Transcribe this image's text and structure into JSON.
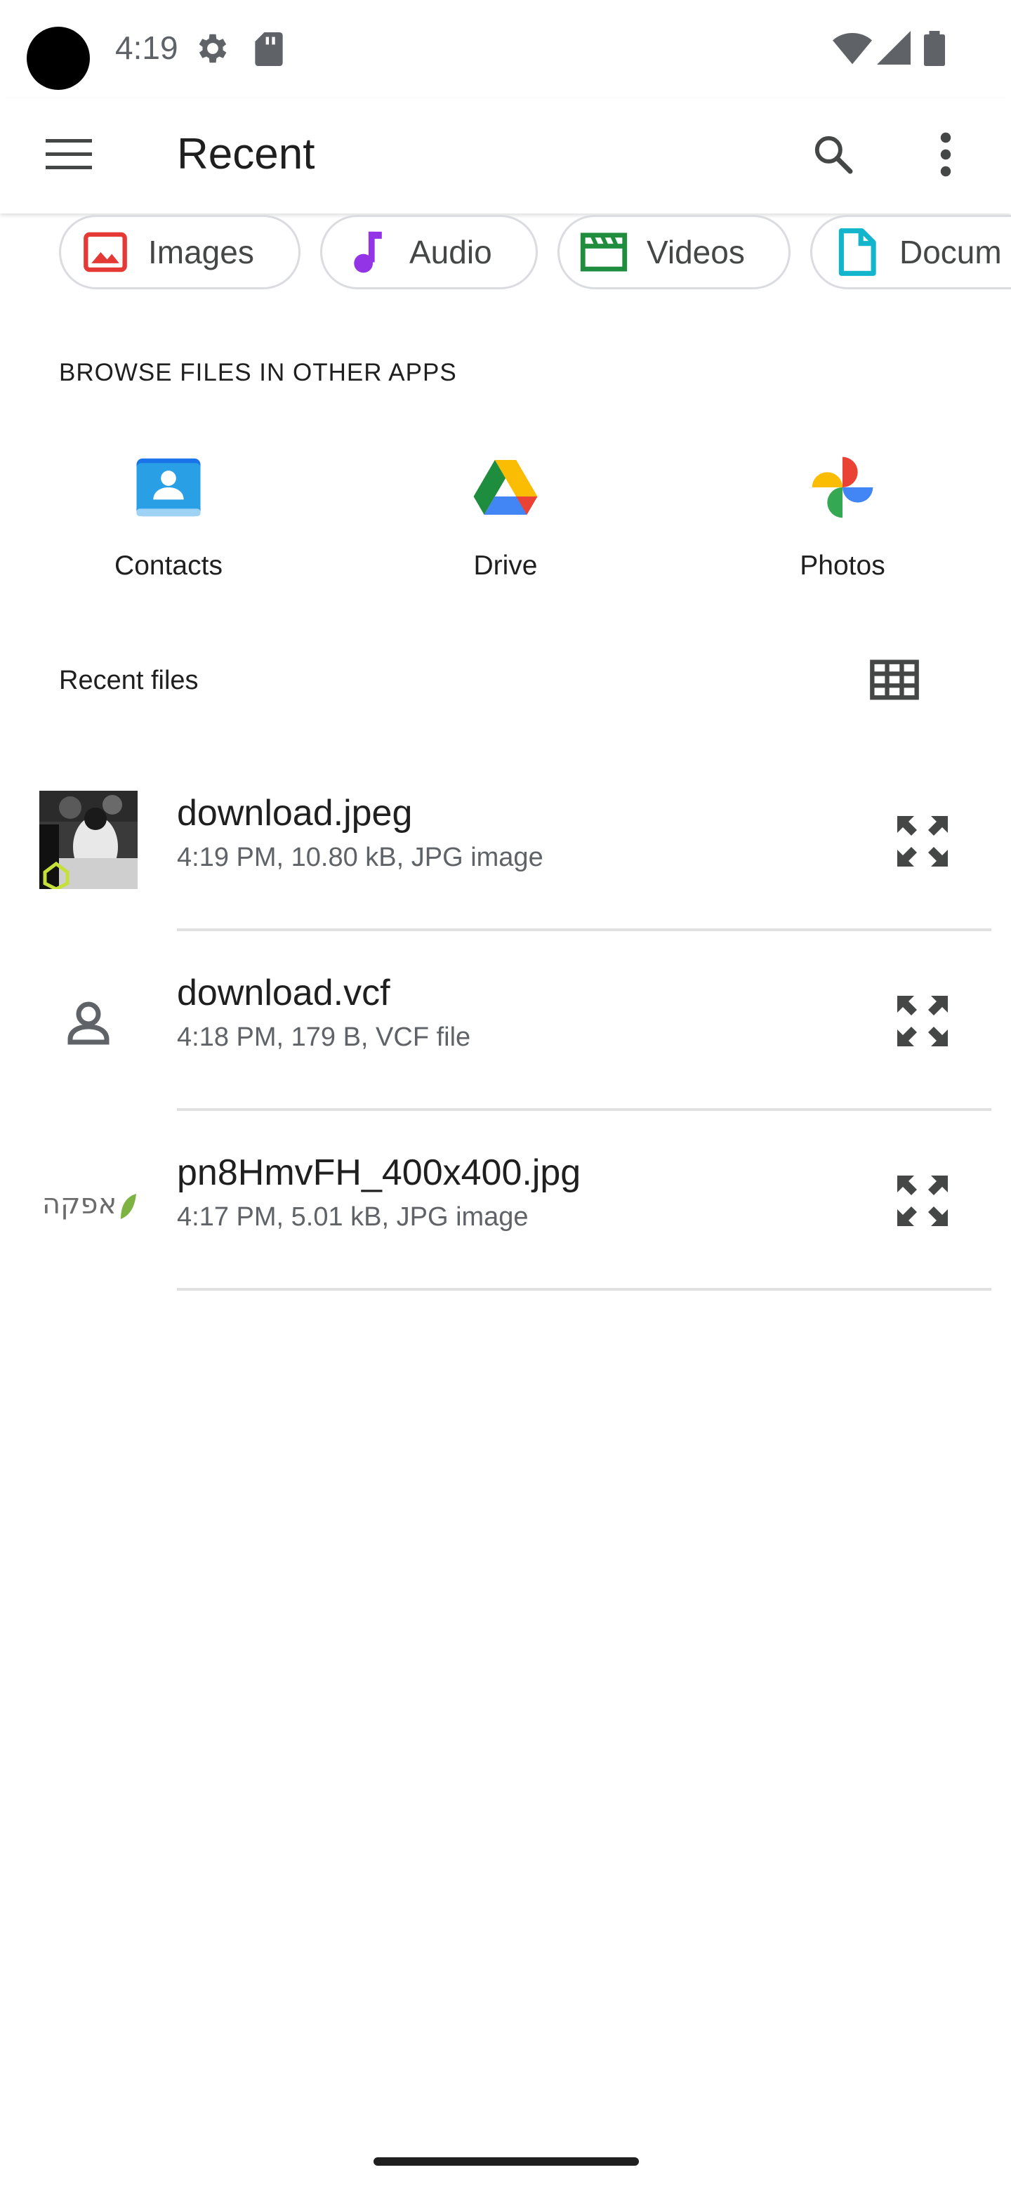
{
  "status_bar": {
    "time": "4:19"
  },
  "app_bar": {
    "title": "Recent"
  },
  "chips": [
    {
      "label": "Images",
      "icon": "image-icon",
      "color": "#e53935"
    },
    {
      "label": "Audio",
      "icon": "music-note-icon",
      "color": "#9334e6"
    },
    {
      "label": "Videos",
      "icon": "video-icon",
      "color": "#1e8e3e"
    },
    {
      "label": "Docum",
      "icon": "document-icon",
      "color": "#12b5cb"
    }
  ],
  "browse": {
    "heading": "BROWSE FILES IN OTHER APPS",
    "apps": [
      {
        "label": "Contacts",
        "icon": "contacts-app-icon"
      },
      {
        "label": "Drive",
        "icon": "drive-app-icon"
      },
      {
        "label": "Photos",
        "icon": "photos-app-icon"
      }
    ]
  },
  "recent": {
    "heading": "Recent files",
    "files": [
      {
        "name": "download.jpeg",
        "meta": "4:19 PM, 10.80 kB, JPG image",
        "thumb": "photo-thumbnail"
      },
      {
        "name": "download.vcf",
        "meta": "4:18 PM, 179 B, VCF file",
        "thumb": "contact-file-icon"
      },
      {
        "name": "pn8HmvFH_400x400.jpg",
        "meta": "4:17 PM, 5.01 kB, JPG image",
        "thumb": "logo-thumbnail",
        "thumb_text": "אפקה"
      }
    ]
  }
}
